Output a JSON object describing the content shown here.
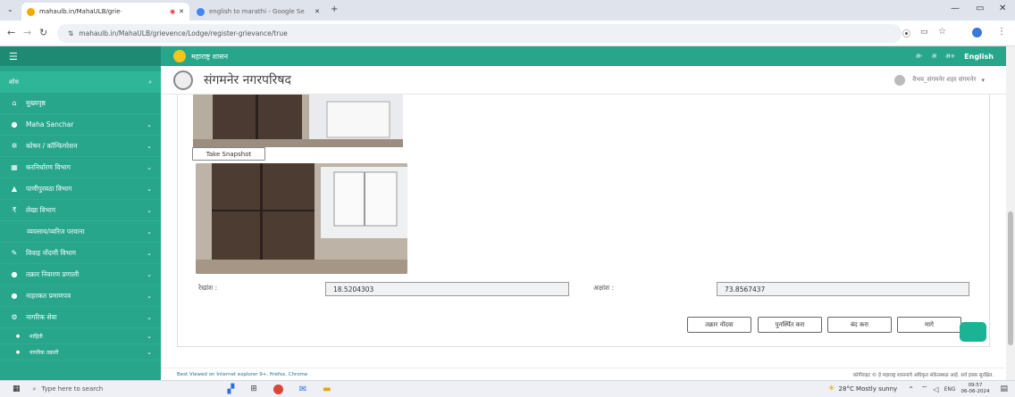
{
  "browser": {
    "tabs": [
      {
        "title": "mahaulb.in/MahaULB/grie·"
      },
      {
        "title": "english to marathi - Google Se"
      }
    ],
    "new_tab": "+",
    "url": "mahaulb.in/MahaULB/grievence/Lodge/register-grievance/true"
  },
  "sidebar": {
    "search_label": "शोध",
    "items": [
      {
        "icon": "home-icon",
        "label": "मुख्यपृष्ठ",
        "chevron": false
      },
      {
        "icon": "circle-icon",
        "label": "Maha Sanchar",
        "chevron": true
      },
      {
        "icon": "gear-icon",
        "label": "कोषन / कॉन्फिगरेशन",
        "chevron": true
      },
      {
        "icon": "building-icon",
        "label": "करनिर्धारण विभाग",
        "chevron": true
      },
      {
        "icon": "drop-icon",
        "label": "पाणीपुरवठा विभाग",
        "chevron": true
      },
      {
        "icon": "rupee-icon",
        "label": "लेखा विभाग",
        "chevron": true
      },
      {
        "icon": "none",
        "label": "व्यवसाय/व्यरिज परवाना",
        "chevron": true
      },
      {
        "icon": "ring-icon",
        "label": "विवाह नोंदणी विभाग",
        "chevron": true
      },
      {
        "icon": "chat-icon",
        "label": "तक्रार निवारण प्रणाली",
        "chevron": true
      },
      {
        "icon": "circle-icon",
        "label": "नाहरकत प्रमाणपत्र",
        "chevron": true
      },
      {
        "icon": "gears-icon",
        "label": "नागरिक सेवा",
        "chevron": true
      },
      {
        "icon": "dot-icon",
        "label": "माहिती",
        "chevron": true
      },
      {
        "icon": "dot-icon",
        "label": "नागरिक तक्रारी",
        "chevron": true
      }
    ]
  },
  "topstrip": {
    "title": "महाराष्ट्र शासन",
    "font_sizes": [
      "अ-",
      "अ",
      "अ+"
    ],
    "language": "English"
  },
  "header": {
    "org_name": "संगमनेर नगरपरिषद",
    "user": "वैभव_संगमनेर शहर संगमनेर"
  },
  "content": {
    "snapshot_button": "Take Snapshot",
    "latitude_label": "रेखांश :",
    "latitude_value": "18.5204303",
    "longitude_label": "अक्षांश :",
    "longitude_value": "73.8567437",
    "actions": {
      "submit": "तक्रार नोंदवा",
      "reset": "पुनर्स्थित करा",
      "close": "बंद करा",
      "back": "मागे"
    }
  },
  "footer": {
    "left": "Best Viewed on Internet explorer 9+, firefox, Chrome",
    "right": "कॉपीराइट © हे महाराष्ट्र शासनाचे अधिकृत संकेतस्थळ आहे. सर्व हक्क सुरक्षित."
  },
  "taskbar": {
    "search_placeholder": "Type here to search",
    "weather": "28°C Mostly sunny",
    "lang": "ENG",
    "time": "09:57",
    "date": "06-06-2024"
  },
  "colors": {
    "sidebar": "#27a68c",
    "accent": "#1ab394"
  }
}
